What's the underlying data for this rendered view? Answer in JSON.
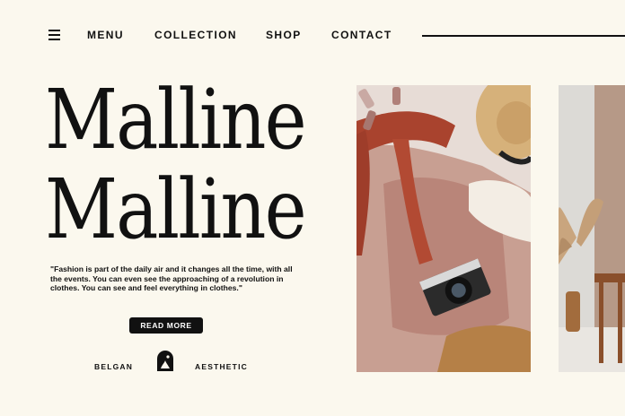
{
  "nav": {
    "menu_label": "MENU",
    "links": [
      "COLLECTION",
      "SHOP",
      "CONTACT"
    ]
  },
  "hero": {
    "title_line1": "Malline",
    "title_line2": "Malline",
    "quote": "\"Fashion is part of the daily air and it changes all the time, with all the events. You can even see the approaching of a revolution in clothes. You can see and feel everything in clothes.\"",
    "cta_label": "READ MORE"
  },
  "footer": {
    "left_label": "BELGAN",
    "right_label": "AESTHETIC"
  },
  "colors": {
    "background": "#fbf8ee",
    "text": "#111111",
    "button": "#111111"
  }
}
